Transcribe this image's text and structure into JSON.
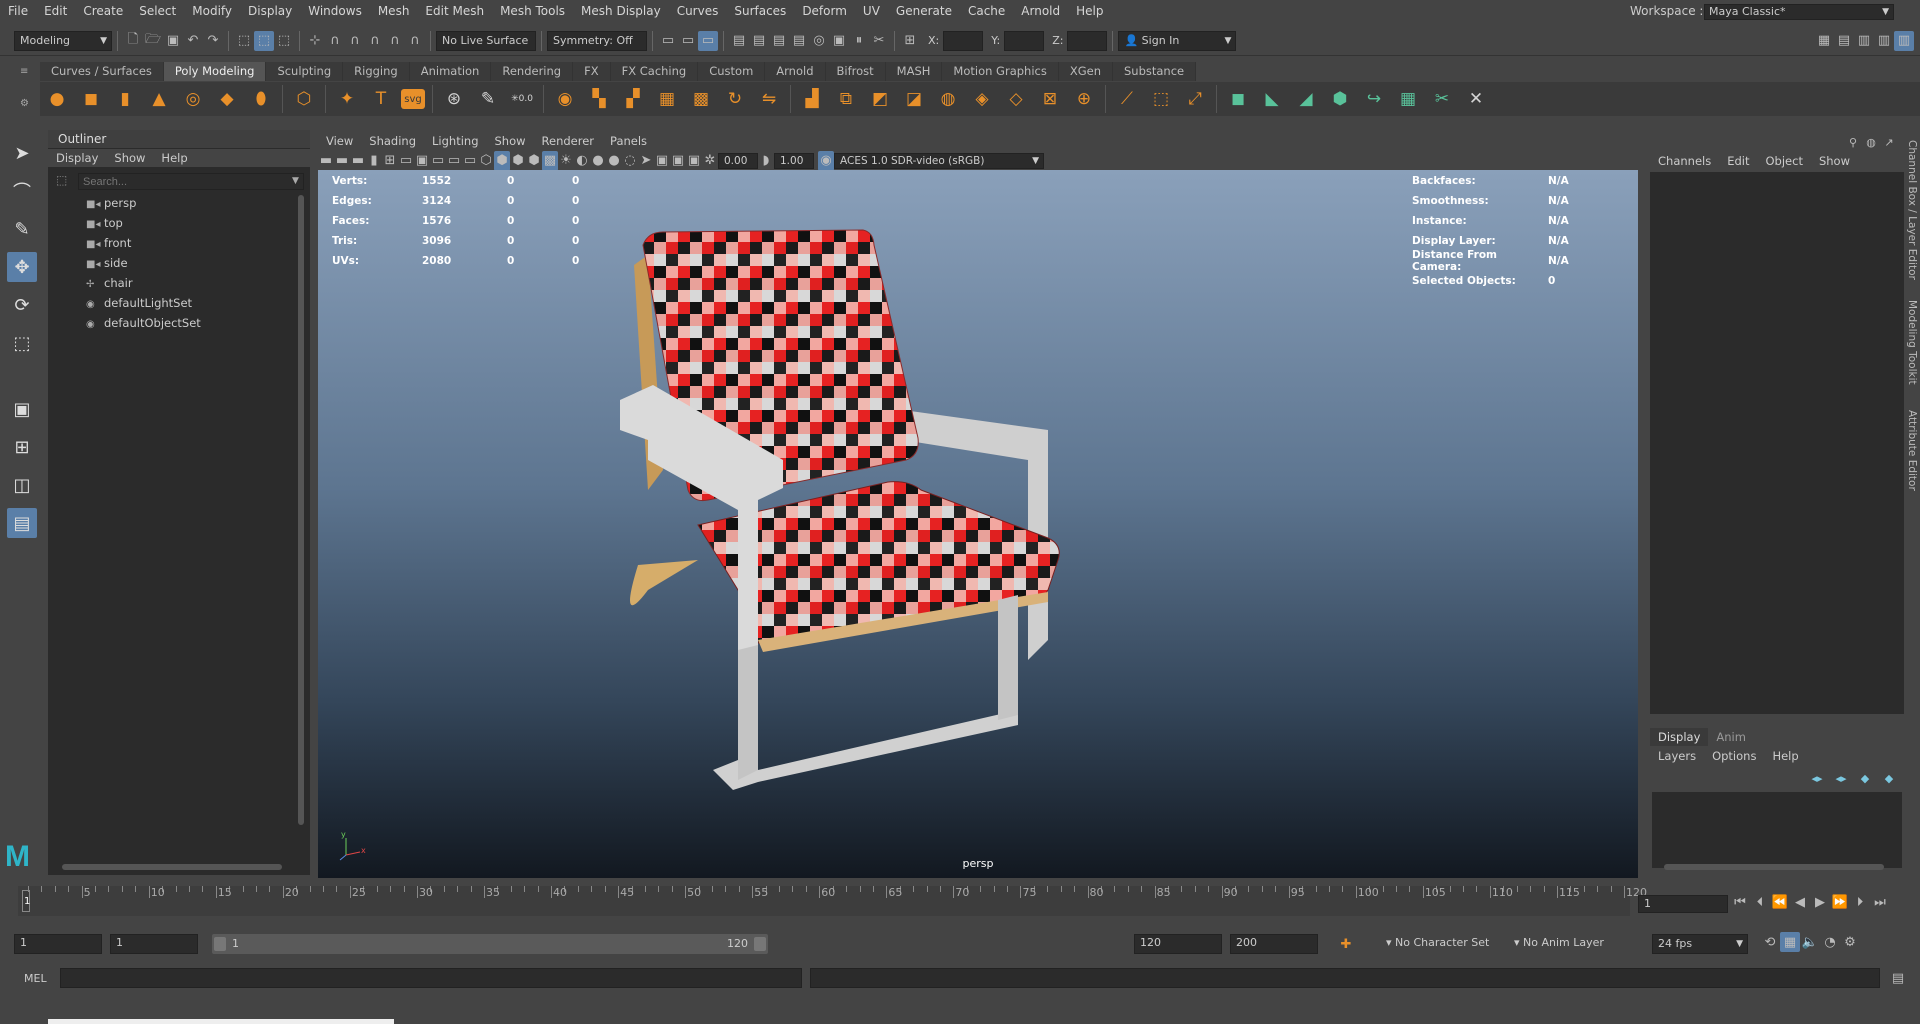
{
  "menubar": {
    "items": [
      "File",
      "Edit",
      "Create",
      "Select",
      "Modify",
      "Display",
      "Windows",
      "Mesh",
      "Edit Mesh",
      "Mesh Tools",
      "Mesh Display",
      "Curves",
      "Surfaces",
      "Deform",
      "UV",
      "Generate",
      "Cache",
      "Arnold",
      "Help"
    ],
    "workspace_label": "Workspace :",
    "workspace_value": "Maya Classic*"
  },
  "statusline": {
    "mode": "Modeling",
    "live_surface": "No Live Surface",
    "symmetry": "Symmetry: Off",
    "x_label": "X:",
    "y_label": "Y:",
    "z_label": "Z:",
    "sign_in": "Sign In"
  },
  "shelf": {
    "tabs": [
      "Curves / Surfaces",
      "Poly Modeling",
      "Sculpting",
      "Rigging",
      "Animation",
      "Rendering",
      "FX",
      "FX Caching",
      "Custom",
      "Arnold",
      "Bifrost",
      "MASH",
      "Motion Graphics",
      "XGen",
      "Substance"
    ],
    "active_tab": "Poly Modeling",
    "svg_label": "svg",
    "number_label": "0.0"
  },
  "outliner": {
    "title": "Outliner",
    "menu": [
      "Display",
      "Show",
      "Help"
    ],
    "search_placeholder": "Search...",
    "items": [
      {
        "label": "persp",
        "icon": "camera-icon"
      },
      {
        "label": "top",
        "icon": "camera-icon"
      },
      {
        "label": "front",
        "icon": "camera-icon"
      },
      {
        "label": "side",
        "icon": "camera-icon"
      },
      {
        "label": "chair",
        "icon": "transform-icon"
      },
      {
        "label": "defaultLightSet",
        "icon": "set-icon"
      },
      {
        "label": "defaultObjectSet",
        "icon": "set-icon"
      }
    ]
  },
  "viewport": {
    "menu": [
      "View",
      "Shading",
      "Lighting",
      "Show",
      "Renderer",
      "Panels"
    ],
    "exposure": "0.00",
    "gamma": "1.00",
    "color_space": "ACES 1.0 SDR-video (sRGB)",
    "camera_label": "persp",
    "hud_left": [
      {
        "label": "Verts:",
        "v1": "1552",
        "v2": "0",
        "v3": "0"
      },
      {
        "label": "Edges:",
        "v1": "3124",
        "v2": "0",
        "v3": "0"
      },
      {
        "label": "Faces:",
        "v1": "1576",
        "v2": "0",
        "v3": "0"
      },
      {
        "label": "Tris:",
        "v1": "3096",
        "v2": "0",
        "v3": "0"
      },
      {
        "label": "UVs:",
        "v1": "2080",
        "v2": "0",
        "v3": "0"
      }
    ],
    "hud_right": [
      {
        "label": "Backfaces:",
        "value": "N/A"
      },
      {
        "label": "Smoothness:",
        "value": "N/A"
      },
      {
        "label": "Instance:",
        "value": "N/A"
      },
      {
        "label": "Display Layer:",
        "value": "N/A"
      },
      {
        "label": "Distance From Camera:",
        "value": "N/A"
      },
      {
        "label": "Selected Objects:",
        "value": "0"
      }
    ],
    "axis_y": "y",
    "axis_x": "x"
  },
  "channelbox": {
    "menu": [
      "Channels",
      "Edit",
      "Object",
      "Show"
    ],
    "side_tabs": [
      "Channel Box / Layer Editor",
      "Modeling Toolkit",
      "Attribute Editor"
    ]
  },
  "layer_editor": {
    "tabs": [
      "Display",
      "Anim"
    ],
    "active_tab": "Display",
    "menu": [
      "Layers",
      "Options",
      "Help"
    ]
  },
  "timeline": {
    "ticks": [
      "5",
      "10",
      "15",
      "20",
      "25",
      "30",
      "35",
      "40",
      "45",
      "50",
      "55",
      "60",
      "65",
      "70",
      "75",
      "80",
      "85",
      "90",
      "95",
      "100",
      "105",
      "110",
      "115",
      "120"
    ],
    "current_marker": "1",
    "current_frame": "1"
  },
  "range": {
    "start": "1",
    "playback_start": "1",
    "bar_start": "1",
    "bar_end": "120",
    "playback_end": "120",
    "end": "200",
    "character_set": "No Character Set",
    "anim_layer": "No Anim Layer",
    "fps": "24 fps"
  },
  "command": {
    "language": "MEL"
  },
  "colors": {
    "accent": "#5a7fa8",
    "shelf_orange": "#e8902a",
    "shelf_green": "#59c29a",
    "maya_logo": "#2fb5c8"
  }
}
